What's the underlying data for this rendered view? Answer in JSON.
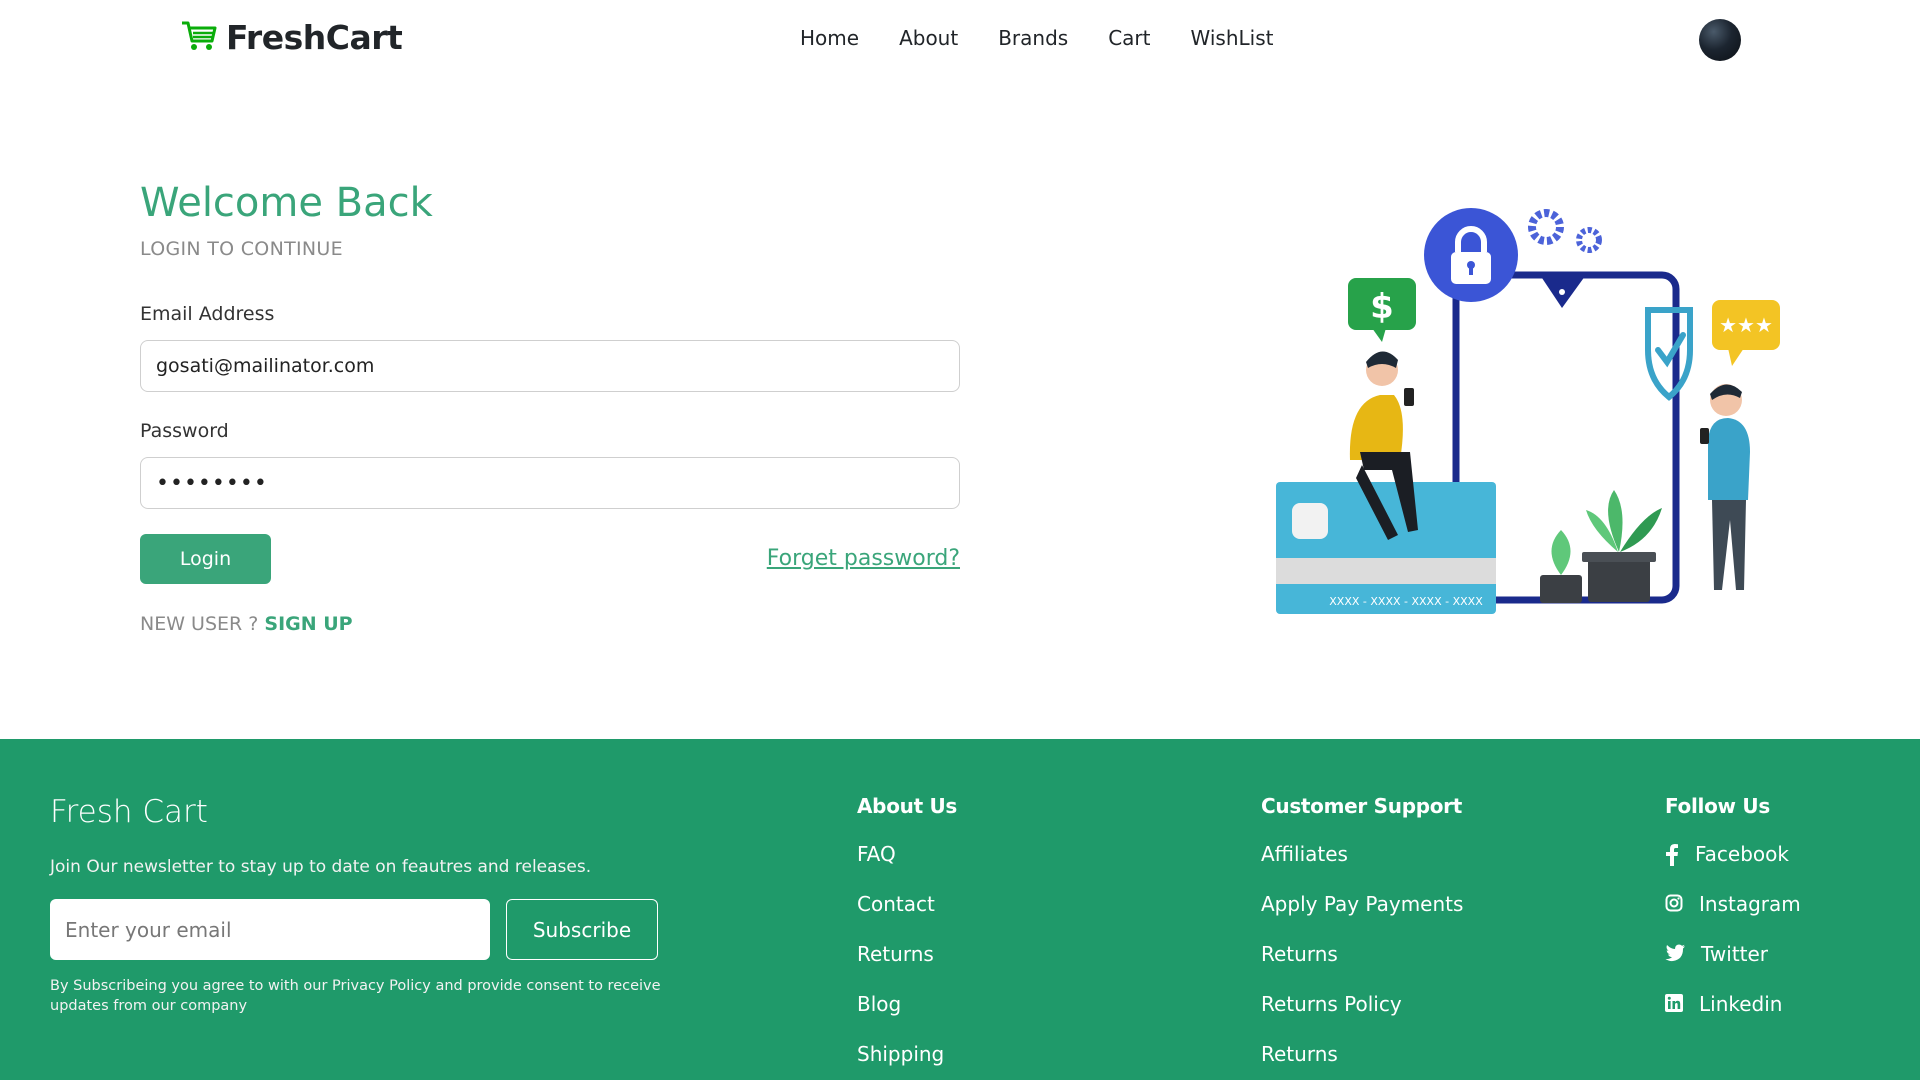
{
  "brand": {
    "name": "FreshCart"
  },
  "nav": {
    "links": [
      "Home",
      "About",
      "Brands",
      "Cart",
      "WishList"
    ]
  },
  "login": {
    "title": "Welcome Back",
    "subtitle": "LOGIN TO CONTINUE",
    "email_label": "Email Address",
    "email_value": "gosati@mailinator.com",
    "password_label": "Password",
    "password_value": "••••••••",
    "login_button": "Login",
    "forget_link": "Forget password?",
    "new_user_text": "NEW USER ? ",
    "signup_link": "SIGN UP"
  },
  "illustration": {
    "card_number": "XXXX - XXXX - XXXX - XXXX",
    "money_symbol": "$"
  },
  "footer": {
    "title": "Fresh Cart",
    "description": "Join Our newsletter to stay up to date on feautres and releases.",
    "email_placeholder": "Enter your email",
    "subscribe_button": "Subscribe",
    "note": "By Subscribeing you agree to with our Privacy Policy and provide consent to receive updates from our company",
    "about": {
      "heading": "About Us",
      "items": [
        "FAQ",
        "Contact",
        "Returns",
        "Blog",
        "Shipping"
      ]
    },
    "support": {
      "heading": "Customer Support",
      "items": [
        "Affiliates",
        "Apply Pay Payments",
        "Returns",
        "Returns Policy",
        "Returns"
      ]
    },
    "follow": {
      "heading": "Follow Us",
      "items": [
        {
          "label": "Facebook",
          "icon": "facebook-icon"
        },
        {
          "label": "Instagram",
          "icon": "instagram-icon"
        },
        {
          "label": "Twitter",
          "icon": "twitter-icon"
        },
        {
          "label": "Linkedin",
          "icon": "linkedin-icon"
        }
      ]
    }
  },
  "colors": {
    "accent": "#3aa57a",
    "footer_bg": "#1f9a6a",
    "text": "#212529",
    "muted": "#8a8a8a"
  }
}
